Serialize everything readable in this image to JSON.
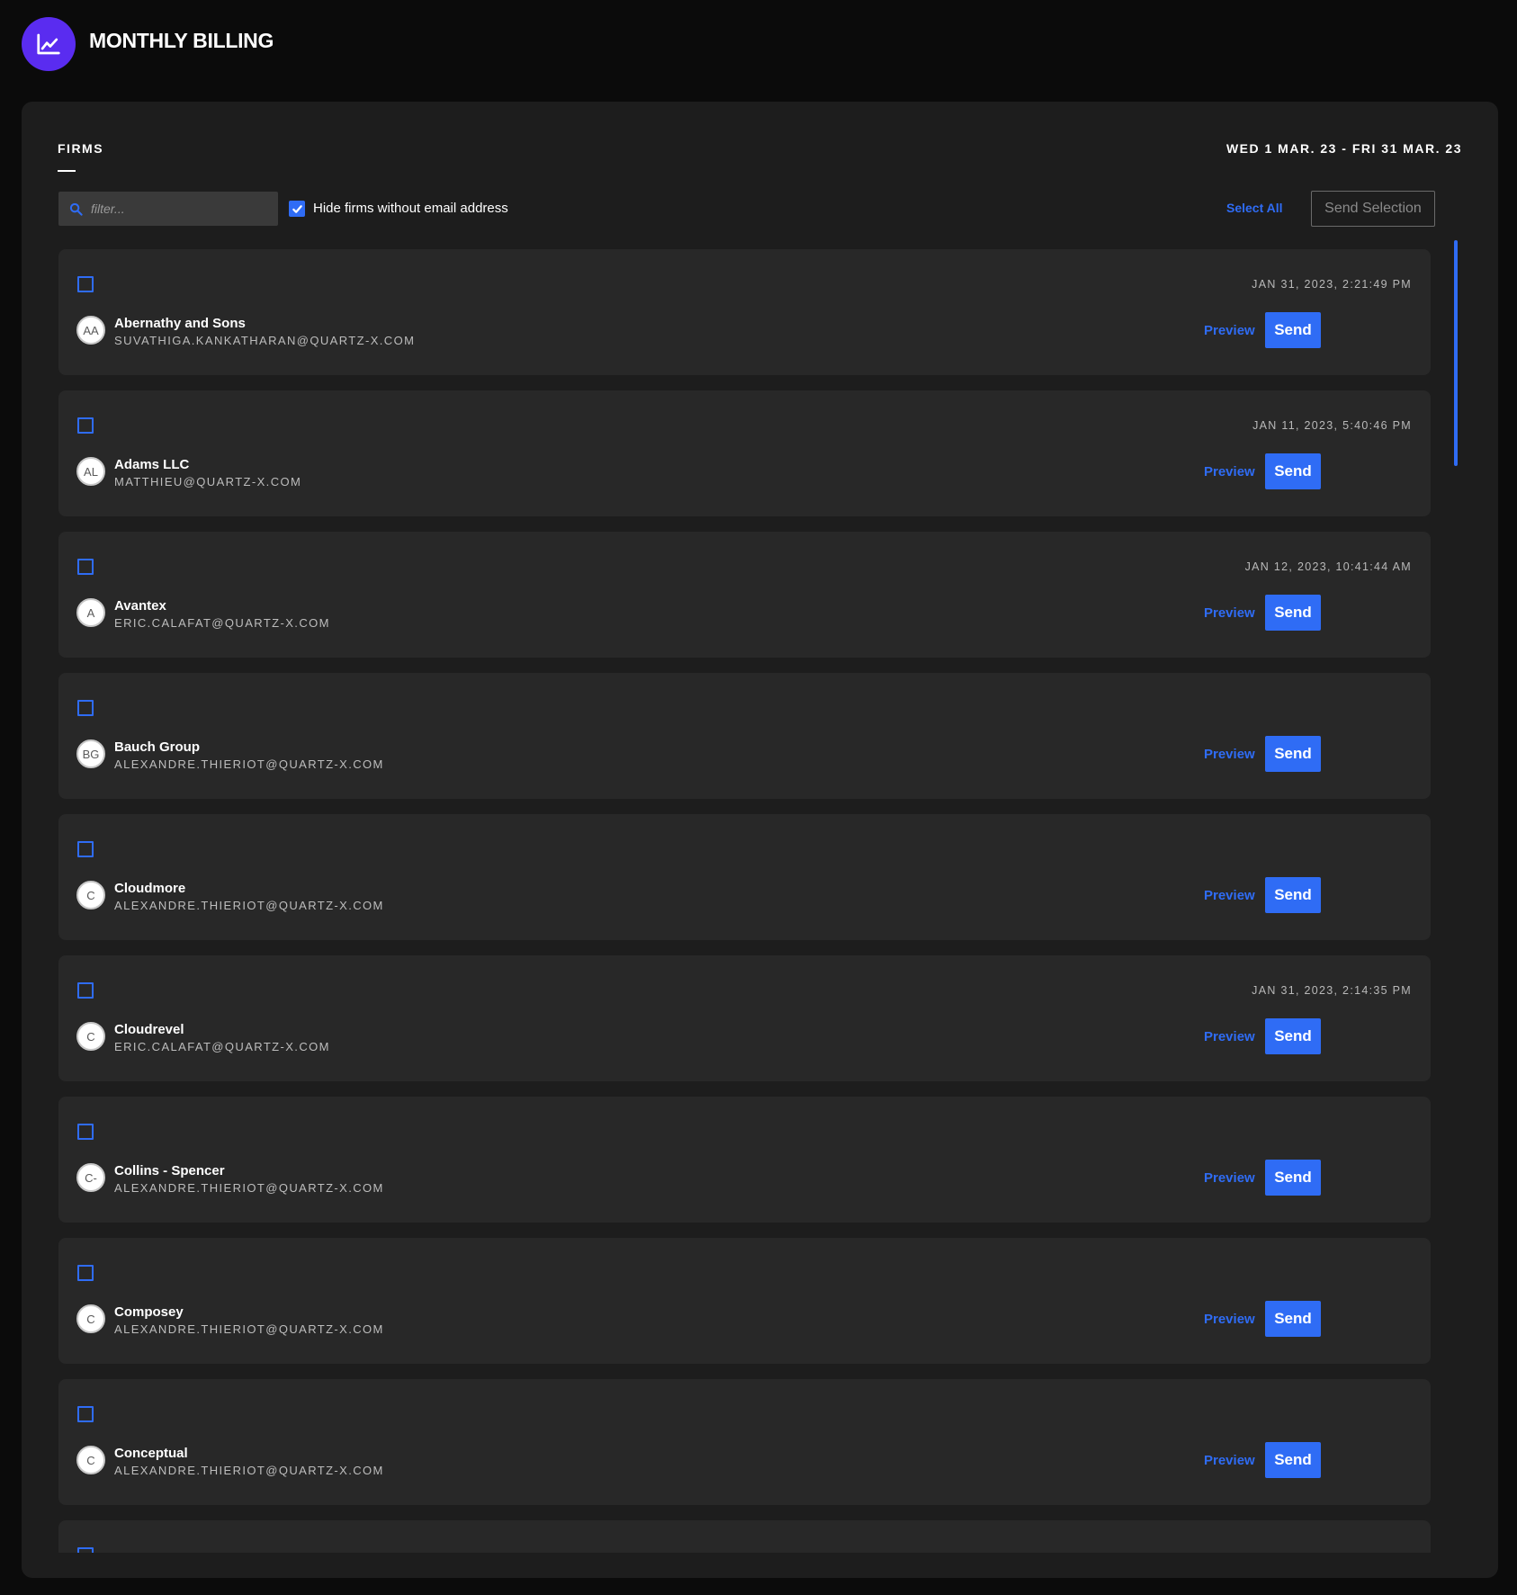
{
  "app": {
    "title": "MONTHLY BILLING",
    "icon": "chart-line-icon",
    "accent_color": "#5a2cf0"
  },
  "panel": {
    "tab_label": "FIRMS",
    "date_range": "WED 1 MAR. 23 - FRI 31 MAR. 23"
  },
  "toolbar": {
    "filter_placeholder": "filter...",
    "hide_label": "Hide firms without email address",
    "hide_checked": true,
    "select_all_label": "Select All",
    "send_selection_label": "Send Selection"
  },
  "firm_actions": {
    "preview_label": "Preview",
    "send_label": "Send"
  },
  "firms": [
    {
      "initials": "AA",
      "name": "Abernathy and Sons",
      "email": "SUVATHIGA.KANKATHARAN@QUARTZ-X.COM",
      "timestamp": "JAN 31, 2023, 2:21:49 PM"
    },
    {
      "initials": "AL",
      "name": "Adams LLC",
      "email": "MATTHIEU@QUARTZ-X.COM",
      "timestamp": "JAN 11, 2023, 5:40:46 PM"
    },
    {
      "initials": "A",
      "name": "Avantex",
      "email": "ERIC.CALAFAT@QUARTZ-X.COM",
      "timestamp": "JAN 12, 2023, 10:41:44 AM"
    },
    {
      "initials": "BG",
      "name": "Bauch Group",
      "email": "ALEXANDRE.THIERIOT@QUARTZ-X.COM",
      "timestamp": ""
    },
    {
      "initials": "C",
      "name": "Cloudmore",
      "email": "ALEXANDRE.THIERIOT@QUARTZ-X.COM",
      "timestamp": ""
    },
    {
      "initials": "C",
      "name": "Cloudrevel",
      "email": "ERIC.CALAFAT@QUARTZ-X.COM",
      "timestamp": "JAN 31, 2023, 2:14:35 PM"
    },
    {
      "initials": "C-",
      "name": "Collins - Spencer",
      "email": "ALEXANDRE.THIERIOT@QUARTZ-X.COM",
      "timestamp": ""
    },
    {
      "initials": "C",
      "name": "Composey",
      "email": "ALEXANDRE.THIERIOT@QUARTZ-X.COM",
      "timestamp": ""
    },
    {
      "initials": "C",
      "name": "Conceptual",
      "email": "ALEXANDRE.THIERIOT@QUARTZ-X.COM",
      "timestamp": ""
    },
    {
      "initials": "",
      "name": "",
      "email": "",
      "timestamp": ""
    }
  ]
}
